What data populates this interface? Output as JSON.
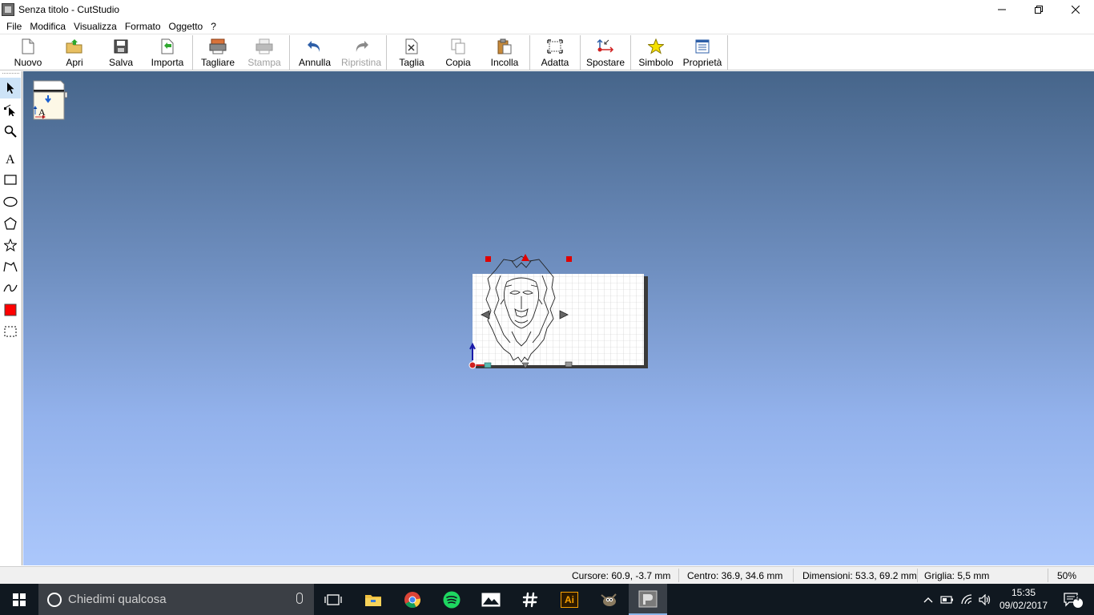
{
  "window": {
    "title": "Senza titolo - CutStudio",
    "controls": [
      "minimize",
      "restore",
      "close"
    ]
  },
  "menu": [
    "File",
    "Modifica",
    "Visualizza",
    "Formato",
    "Oggetto",
    "?"
  ],
  "toolbar": {
    "new": "Nuovo",
    "open": "Apri",
    "save": "Salva",
    "import": "Importa",
    "cut_plot": "Tagliare",
    "print": "Stampa",
    "undo": "Annulla",
    "redo": "Ripristina",
    "cut": "Taglia",
    "copy": "Copia",
    "paste": "Incolla",
    "fit": "Adatta",
    "move": "Spostare",
    "symbol": "Simbolo",
    "properties": "Proprietà"
  },
  "palette": {
    "tools": [
      "select-arrow",
      "edit-node",
      "zoom",
      "text",
      "rectangle",
      "ellipse",
      "polygon",
      "star",
      "polyline",
      "curve",
      "fill-color",
      "marquee"
    ],
    "fill_color": "#ff0000"
  },
  "canvas": {
    "gradient_top": "#46658a",
    "gradient_bottom": "#abc7fb",
    "selection_handle_color": "#e00000"
  },
  "status": {
    "cursor": "Cursore: 60.9, -3.7 mm",
    "center": "Centro: 36.9, 34.6 mm",
    "dimensions": "Dimensioni: 53.3, 69.2 mm",
    "grid": "Griglia: 5,5 mm",
    "zoom": "50%"
  },
  "taskbar": {
    "search_placeholder": "Chiedimi qualcosa",
    "apps": [
      "task-view",
      "file-explorer",
      "chrome",
      "spotify",
      "photos",
      "slack",
      "illustrator",
      "gimp",
      "cutstudio"
    ],
    "illustrator_label": "Ai",
    "clock_time": "15:35",
    "clock_date": "09/02/2017",
    "notifications": "4"
  }
}
